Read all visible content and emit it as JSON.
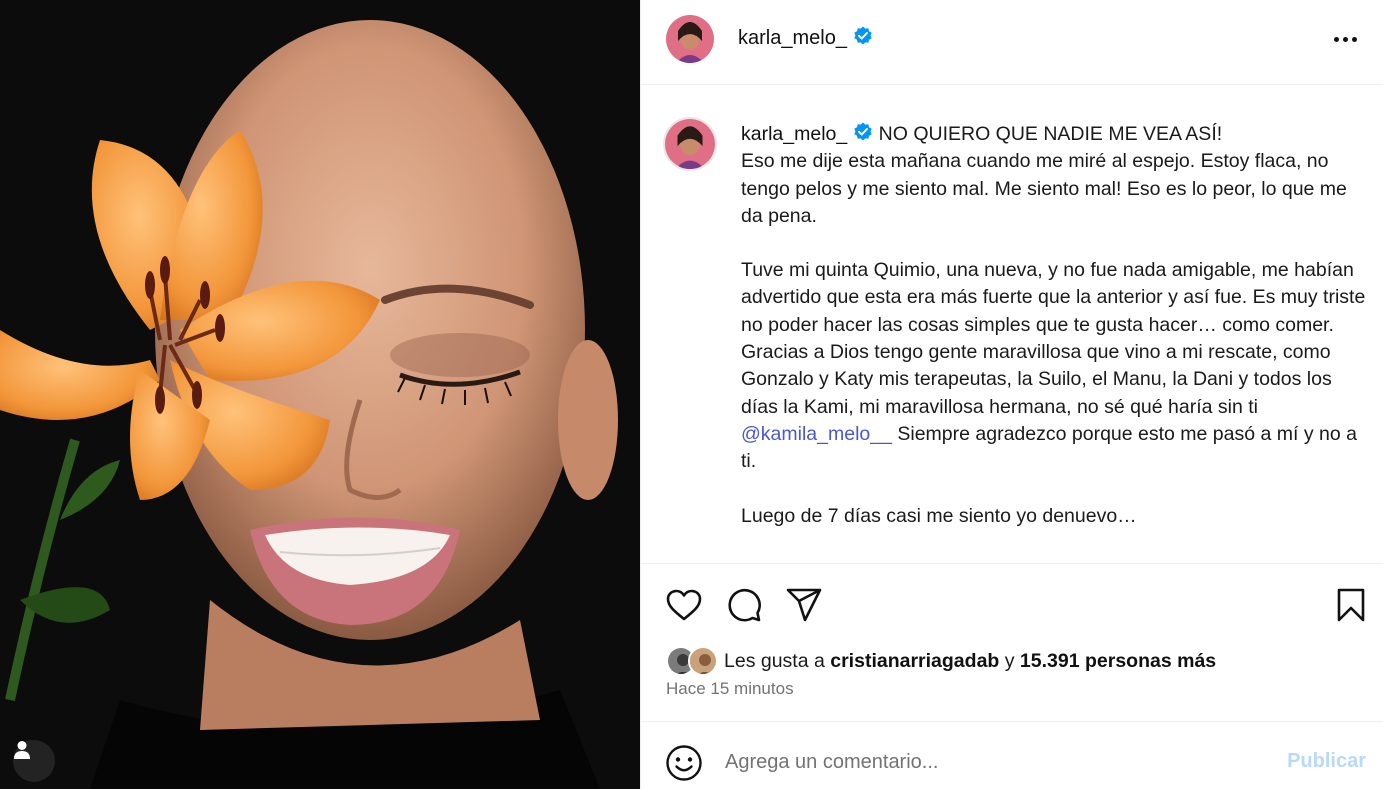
{
  "post": {
    "username": "karla_melo_",
    "verified": true
  },
  "caption": {
    "headline": "NO QUIERO QUE NADIE ME VEA ASÍ!",
    "paragraph1": "Eso me dije esta mañana cuando me miré al espejo. Estoy flaca, no tengo pelos y me siento mal. Me siento mal! Eso es lo peor, lo que me da pena.",
    "paragraph2": "Tuve mi quinta Quimio, una nueva, y no fue nada amigable, me habían advertido que esta era más fuerte que la anterior y así fue. Es muy triste no poder hacer las cosas simples que te gusta hacer… como comer.",
    "paragraph3_before": "Gracias a Dios tengo gente maravillosa que vino a mi rescate, como Gonzalo y Katy mis terapeutas, la Suilo, el Manu, la Dani y todos los días la Kami, mi maravillosa hermana, no sé qué haría sin ti ",
    "mention": "@kamila_melo__",
    "paragraph3_after": " Siempre agradezco porque esto me pasó a mí y no a ti.",
    "paragraph4": "Luego de 7 días casi me siento yo denuevo…"
  },
  "likes": {
    "prefix": "Les gusta a ",
    "user": "cristianarriagadab",
    "connector": " y ",
    "count": "15.391 personas más"
  },
  "timestamp": "Hace 15 minutos",
  "comment": {
    "placeholder": "Agrega un comentario...",
    "publish_label": "Publicar"
  },
  "icons": {
    "more": "more-options-icon",
    "like": "heart-icon",
    "comment": "comment-icon",
    "share": "share-icon",
    "save": "bookmark-icon",
    "emoji": "emoji-icon",
    "tag": "user-tag-icon",
    "verified": "verified-badge-icon"
  },
  "colors": {
    "verified": "#0095f6",
    "mention": "#4b57d1",
    "publish_disabled": "#b8d9fb",
    "flower": "#f39a3c"
  }
}
